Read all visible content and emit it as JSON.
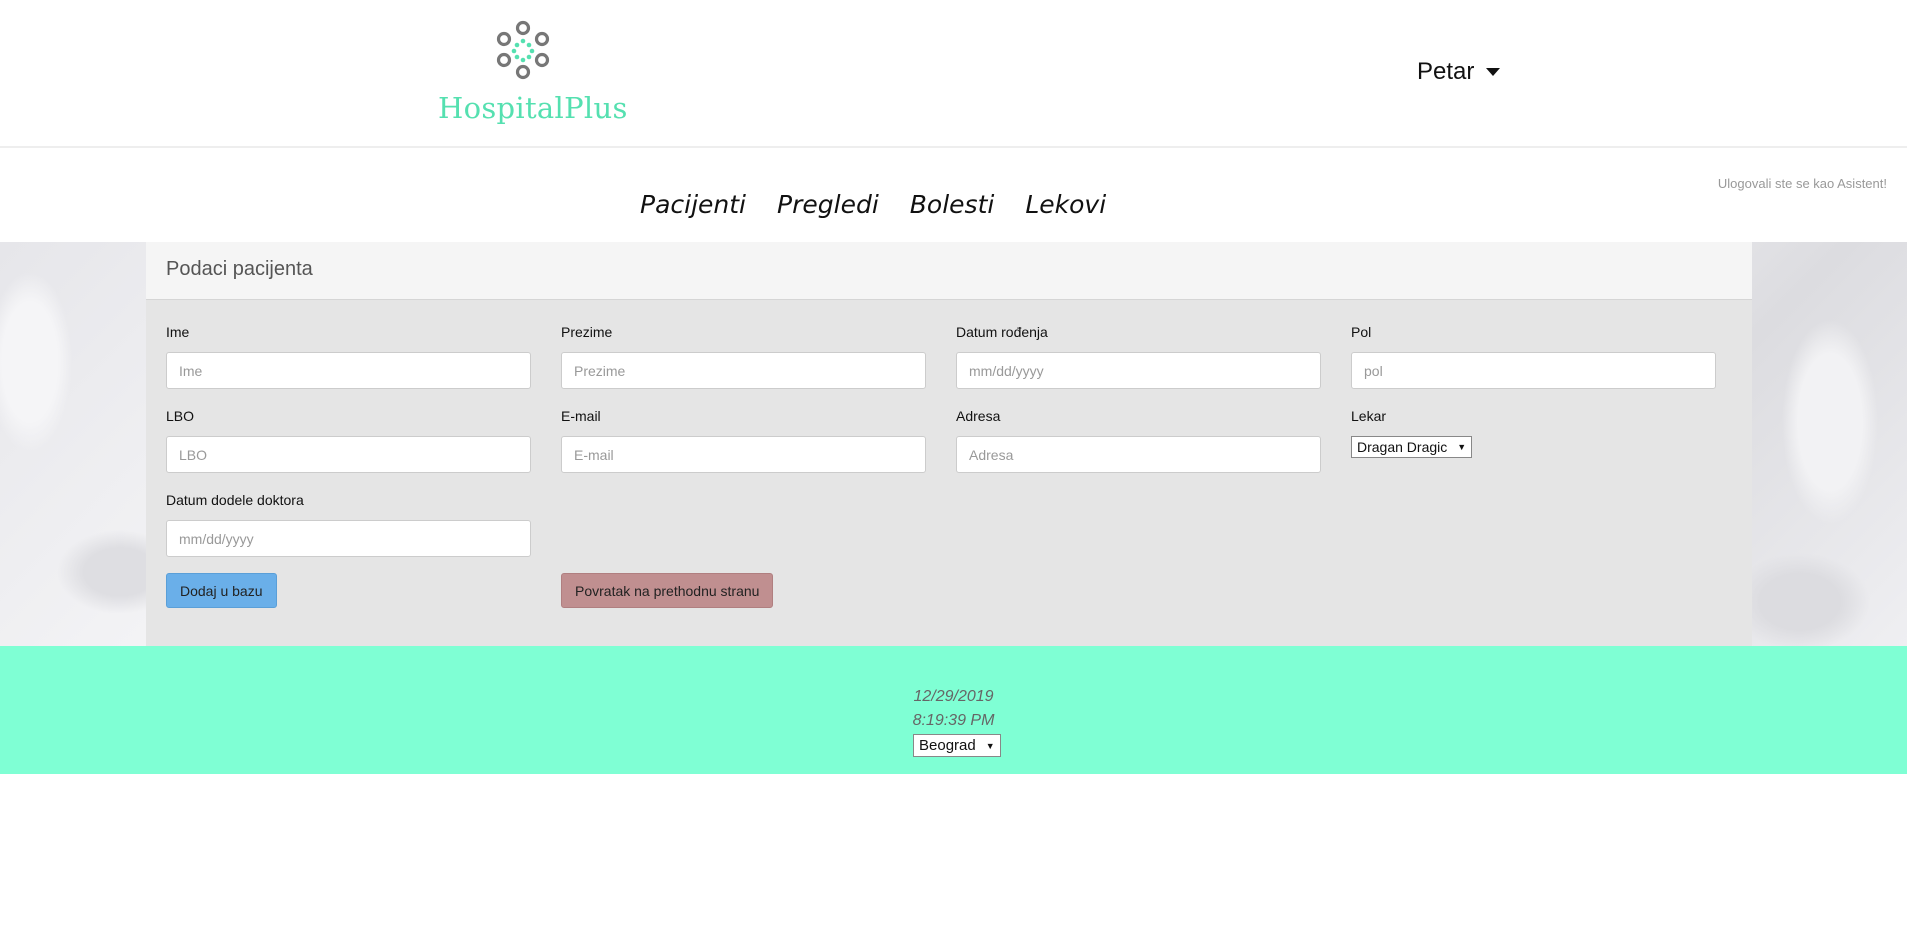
{
  "header": {
    "logo_text": "HospitalPlus",
    "logo_icon": "hospital-plus-logo",
    "user_name": "Petar"
  },
  "nav": {
    "role_note": "Ulogovali ste se kao Asistent!",
    "items": [
      {
        "label": "Pacijenti"
      },
      {
        "label": "Pregledi"
      },
      {
        "label": "Bolesti"
      },
      {
        "label": "Lekovi"
      }
    ]
  },
  "form": {
    "title": "Podaci pacijenta",
    "fields": {
      "ime": {
        "label": "Ime",
        "placeholder": "Ime"
      },
      "prezime": {
        "label": "Prezime",
        "placeholder": "Prezime"
      },
      "datum_rodjenja": {
        "label": "Datum rođenja",
        "placeholder": "mm/dd/yyyy"
      },
      "pol": {
        "label": "Pol",
        "placeholder": "pol"
      },
      "lbo": {
        "label": "LBO",
        "placeholder": "LBO"
      },
      "email": {
        "label": "E-mail",
        "placeholder": "E-mail"
      },
      "adresa": {
        "label": "Adresa",
        "placeholder": "Adresa"
      },
      "lekar": {
        "label": "Lekar",
        "value": "Dragan Dragic"
      },
      "datum_dodele": {
        "label": "Datum dodele doktora",
        "placeholder": "mm/dd/yyyy"
      }
    },
    "submit_label": "Dodaj u bazu",
    "back_label": "Povratak na prethodnu stranu"
  },
  "footer": {
    "date": "12/29/2019",
    "time": "8:19:39 PM",
    "city": "Beograd"
  },
  "colors": {
    "brand": "#55e0b0",
    "footer_bg": "#7fffd4",
    "primary_button": "#6aafe9",
    "back_button": "#c08f90"
  }
}
